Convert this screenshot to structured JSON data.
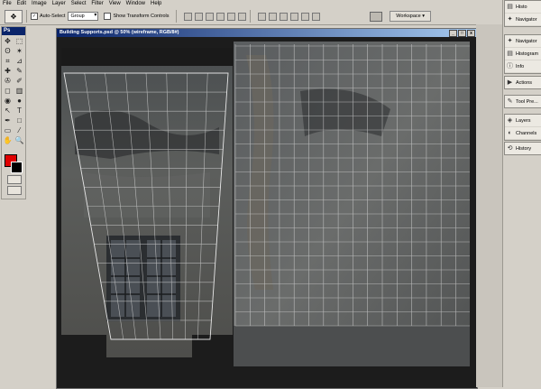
{
  "menu": [
    "File",
    "Edit",
    "Image",
    "Layer",
    "Select",
    "Filter",
    "View",
    "Window",
    "Help"
  ],
  "options_bar": {
    "auto_select_label": "Auto-Select",
    "auto_select_value": "Group",
    "show_transform_label": "Show Transform Controls",
    "workspace_label": "Workspace ▾"
  },
  "toolbox": {
    "header": "Ps",
    "tools": [
      "move-tool",
      "marquee-tool",
      "lasso-tool",
      "magic-wand-tool",
      "crop-tool",
      "slice-tool",
      "healing-brush-tool",
      "brush-tool",
      "clone-stamp-tool",
      "history-brush-tool",
      "eraser-tool",
      "gradient-tool",
      "blur-tool",
      "dodge-tool",
      "path-selection-tool",
      "type-tool",
      "pen-tool",
      "shape-tool",
      "notes-tool",
      "eyedropper-tool",
      "hand-tool",
      "zoom-tool"
    ],
    "glyphs": [
      "✥",
      "⬚",
      "ʘ",
      "✶",
      "⌗",
      "⊿",
      "✚",
      "✎",
      "✇",
      "✐",
      "◻",
      "▥",
      "◉",
      "●",
      "↖",
      "T",
      "✒",
      "□",
      "▭",
      "⁄",
      "✋",
      "🔍"
    ],
    "foreground_color": "#e00000",
    "background_color": "#000000"
  },
  "document": {
    "title": "Building Supports.psd @ 50% (wireframe, RGB/8#)",
    "buttons": [
      "_",
      "□",
      "x"
    ]
  },
  "palettes": {
    "top_group": [
      {
        "label": "Histo",
        "icon": "histogram-icon"
      },
      {
        "label": "Navigator",
        "icon": "navigator-icon"
      }
    ],
    "group2": [
      {
        "label": "Navigator",
        "icon": "navigator-icon"
      },
      {
        "label": "Histogram",
        "icon": "histogram-icon"
      },
      {
        "label": "Info",
        "icon": "info-icon"
      }
    ],
    "actions": {
      "label": "Actions",
      "icon": "actions-icon"
    },
    "tool_presets": {
      "label": "Tool Pre...",
      "icon": "tool-presets-icon"
    },
    "group3": [
      {
        "label": "Layers",
        "icon": "layers-icon"
      },
      {
        "label": "Channels",
        "icon": "channels-icon"
      }
    ],
    "history": {
      "label": "History",
      "icon": "history-icon"
    }
  },
  "colors": {
    "titlebar": "#0a246a",
    "chrome": "#d4d0c8"
  }
}
